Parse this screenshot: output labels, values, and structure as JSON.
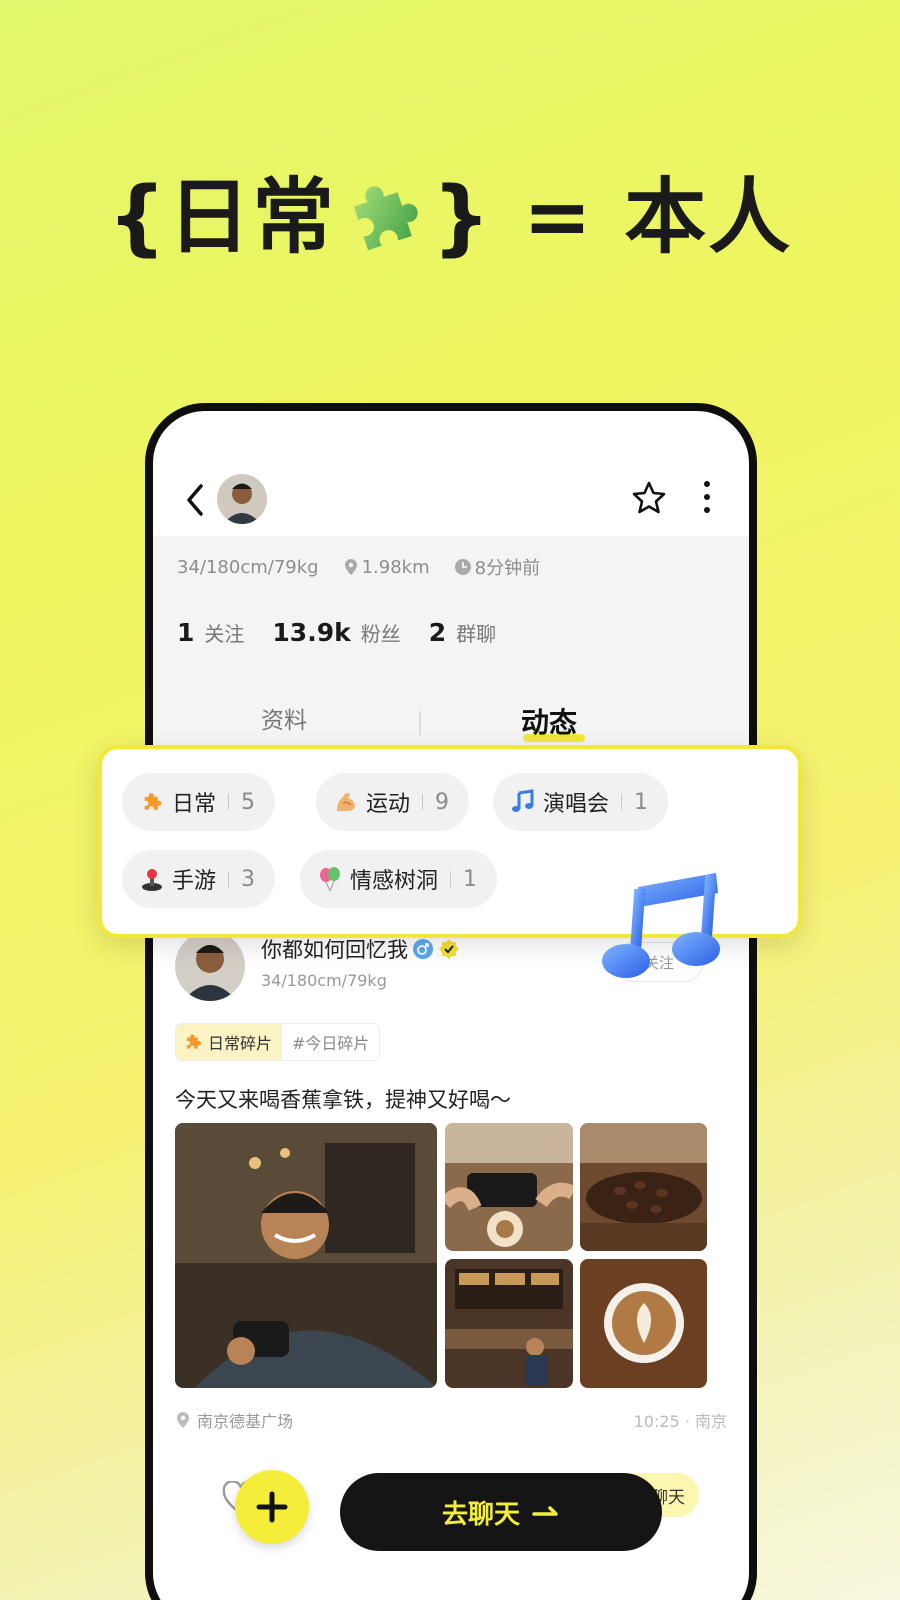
{
  "headline": {
    "prefix": "{日常",
    "suffix": "} = 本人"
  },
  "profile": {
    "meta": {
      "body": "34/180cm/79kg",
      "distance": "1.98km",
      "last_active": "8分钟前"
    },
    "stats": [
      {
        "num": "1",
        "label": "关注"
      },
      {
        "num": "13.9k",
        "label": "粉丝"
      },
      {
        "num": "2",
        "label": "群聊"
      }
    ]
  },
  "tabs": {
    "profile": "资料",
    "moments": "动态"
  },
  "categories": [
    {
      "label": "日常",
      "count": "5",
      "icon": "puzzle-icon"
    },
    {
      "label": "运动",
      "count": "9",
      "icon": "muscle-icon"
    },
    {
      "label": "演唱会",
      "count": "1",
      "icon": "music-note-icon"
    },
    {
      "label": "手游",
      "count": "3",
      "icon": "joystick-icon"
    },
    {
      "label": "情感树洞",
      "count": "1",
      "icon": "balloon-icon"
    }
  ],
  "post": {
    "name": "你都如何回忆我",
    "sub": "34/180cm/79kg",
    "follow": "关注",
    "tag_main": "日常碎片",
    "tag_sub": "#今日碎片",
    "text": "今天又来喝香蕉拿铁，提神又好喝～",
    "location": "南京德基广场",
    "time": "10:25 · 南京",
    "chat_chip": "聊天"
  },
  "actions": {
    "go_chat": "去聊天"
  },
  "colors": {
    "accent_yellow": "#f4ee3a",
    "dark": "#151515"
  }
}
